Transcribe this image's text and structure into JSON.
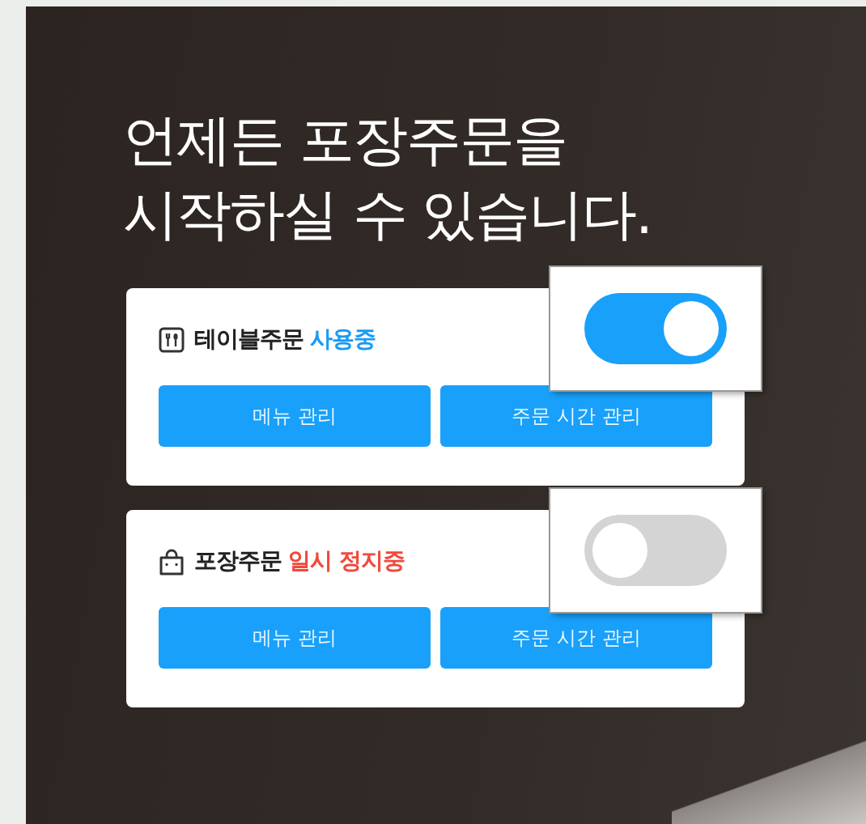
{
  "headline": [
    "언제든 포장주문을",
    "시작하실 수 있습니다."
  ],
  "cards": [
    {
      "kind": "table",
      "title": "테이블주문",
      "status": "사용중",
      "on": true,
      "buttons": [
        "메뉴 관리",
        "주문 시간 관리"
      ]
    },
    {
      "kind": "takeout",
      "title": "포장주문",
      "status": "일시 정지중",
      "on": false,
      "buttons": [
        "메뉴 관리",
        "주문 시간 관리"
      ]
    }
  ]
}
